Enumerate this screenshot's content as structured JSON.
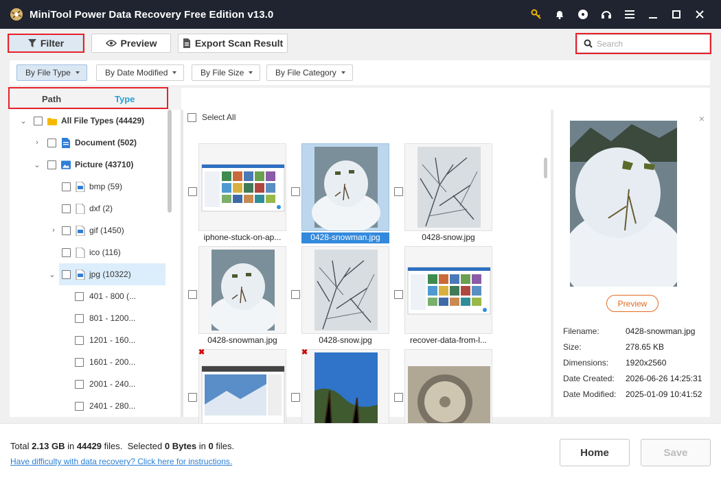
{
  "app": {
    "title": "MiniTool Power Data Recovery Free Edition v13.0"
  },
  "window_controls": [
    "key-icon",
    "bell-icon",
    "disc-icon",
    "headset-icon",
    "menu-icon",
    "minimize-icon",
    "maximize-icon",
    "close-icon"
  ],
  "toolbar": {
    "filter_label": "Filter",
    "preview_label": "Preview",
    "export_label": "Export Scan Result",
    "search_placeholder": "Search"
  },
  "filters": [
    "By File Type",
    "By Date Modified",
    "By File Size",
    "By File Category"
  ],
  "tabs": {
    "path": "Path",
    "type": "Type"
  },
  "tree": [
    {
      "label": "All File Types (44429)",
      "bold": true
    },
    {
      "label": "Document (502)",
      "bold": true
    },
    {
      "label": "Picture (43710)",
      "bold": true
    },
    {
      "label": "bmp (59)"
    },
    {
      "label": "dxf (2)"
    },
    {
      "label": "gif (1450)"
    },
    {
      "label": "ico (116)"
    },
    {
      "label": "jpg (10322)"
    },
    {
      "label": "401 - 800 (..."
    },
    {
      "label": "801 - 1200..."
    },
    {
      "label": "1201 - 160..."
    },
    {
      "label": "1601 - 200..."
    },
    {
      "label": "2001 - 240..."
    },
    {
      "label": "2401 - 280..."
    }
  ],
  "grid": {
    "select_all": "Select All",
    "items": [
      {
        "name": "iphone-stuck-on-ap...",
        "kind": "screenshot"
      },
      {
        "name": "0428-snowman.jpg",
        "kind": "snowman",
        "selected": true
      },
      {
        "name": "0428-snow.jpg",
        "kind": "snowtree"
      },
      {
        "name": "0428-snowman.jpg",
        "kind": "snowman"
      },
      {
        "name": "0428-snow.jpg",
        "kind": "snowtree"
      },
      {
        "name": "recover-data-from-l...",
        "kind": "screenshot"
      },
      {
        "name": "",
        "kind": "browser",
        "deleted": true
      },
      {
        "name": "",
        "kind": "sky",
        "deleted": true
      },
      {
        "name": "",
        "kind": "fan"
      }
    ]
  },
  "details": {
    "preview_label": "Preview",
    "fields": [
      {
        "label": "Filename:",
        "value": "0428-snowman.jpg"
      },
      {
        "label": "Size:",
        "value": "278.65 KB"
      },
      {
        "label": "Dimensions:",
        "value": "1920x2560"
      },
      {
        "label": "Date Created:",
        "value": "2026-06-26 14:25:31"
      },
      {
        "label": "Date Modified:",
        "value": "2025-01-09 10:41:52"
      }
    ]
  },
  "footer": {
    "total_prefix": "Total",
    "total_size": "2.13 GB",
    "in1": "in",
    "total_files": "44429",
    "files1": "files.",
    "selected_prefix": "Selected",
    "selected_size": "0 Bytes",
    "in2": "in",
    "selected_files": "0",
    "files2": "files.",
    "help_link": "Have difficulty with data recovery? Click here for instructions.",
    "home_label": "Home",
    "save_label": "Save"
  },
  "colors": {
    "accent": "#2a9fd6",
    "highlight": "#e8202a",
    "selection": "#3389dc",
    "preview_btn": "#e06a20"
  }
}
